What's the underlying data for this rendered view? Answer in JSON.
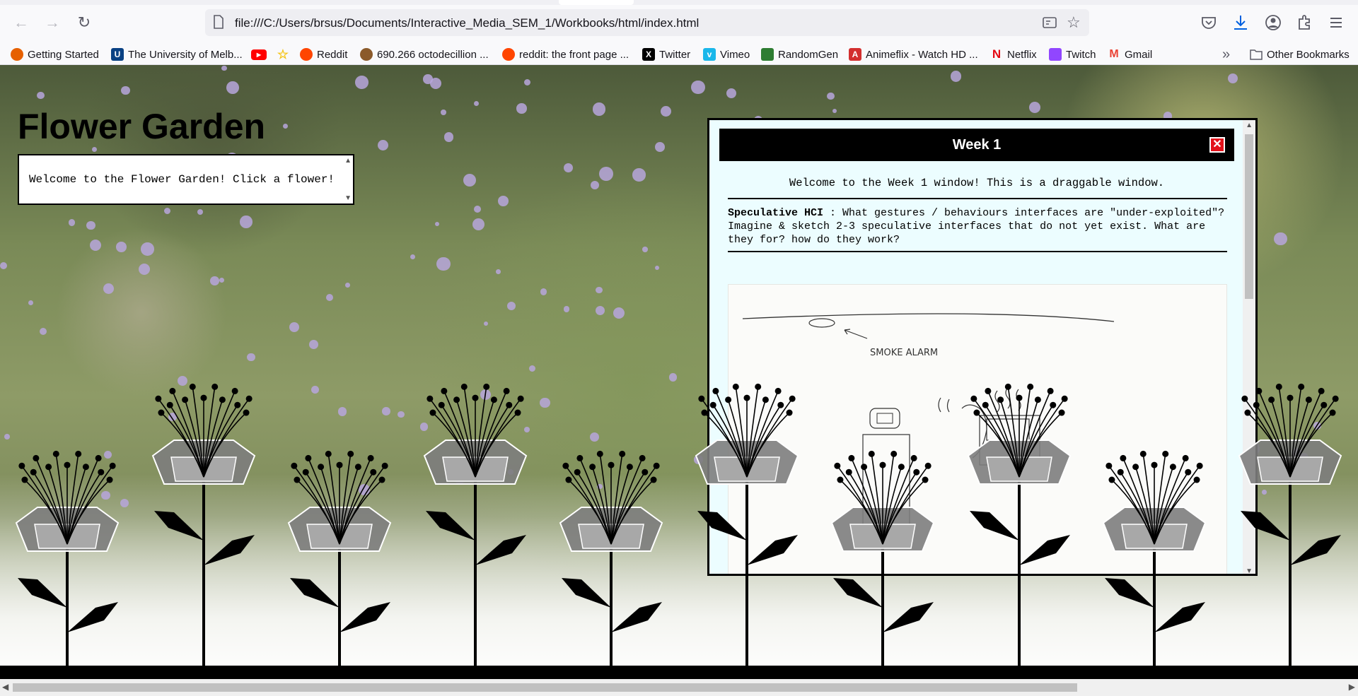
{
  "browser": {
    "url": "file:///C:/Users/brsus/Documents/Interactive_Media_SEM_1/Workbooks/html/index.html",
    "bookmarks": [
      {
        "label": "Getting Started",
        "icon": "firefox-icon",
        "color": "#e66000"
      },
      {
        "label": "The University of Melb...",
        "icon": "unimelb-icon",
        "color": "#094183"
      },
      {
        "label": "",
        "icon": "youtube-icon",
        "color": "#ff0000"
      },
      {
        "label": "",
        "icon": "star-icon",
        "color": "#f5c518"
      },
      {
        "label": "Reddit",
        "icon": "reddit-icon",
        "color": "#ff4500"
      },
      {
        "label": "690.266 octodecillion ...",
        "icon": "cookie-icon",
        "color": "#8b5a2b"
      },
      {
        "label": "reddit: the front page ...",
        "icon": "reddit-icon",
        "color": "#ff4500"
      },
      {
        "label": "Twitter",
        "icon": "x-icon",
        "color": "#000000"
      },
      {
        "label": "Vimeo",
        "icon": "vimeo-icon",
        "color": "#1ab7ea"
      },
      {
        "label": "RandomGen",
        "icon": "randomgen-icon",
        "color": "#2e7d32"
      },
      {
        "label": "Animeflix - Watch HD ...",
        "icon": "animeflix-icon",
        "color": "#d32f2f"
      },
      {
        "label": "Netflix",
        "icon": "netflix-icon",
        "color": "#e50914"
      },
      {
        "label": "Twitch",
        "icon": "twitch-icon",
        "color": "#9146ff"
      },
      {
        "label": "Gmail",
        "icon": "gmail-icon",
        "color": "#ea4335"
      }
    ],
    "other_bookmarks": "Other Bookmarks"
  },
  "page": {
    "title": "Flower Garden",
    "message": "Welcome to the Flower Garden! Click a flower!"
  },
  "window": {
    "title": "Week 1",
    "intro": "Welcome to the Week 1 window! This is a draggable window.",
    "topic_bold": "Speculative HCI",
    "topic_text": " : What gestures / behaviours interfaces are \"under-exploited\"? Imagine & sketch 2-3 speculative interfaces that do not yet exist. What are they for? how do they work?",
    "sketch_label": "SMOKE ALARM"
  }
}
